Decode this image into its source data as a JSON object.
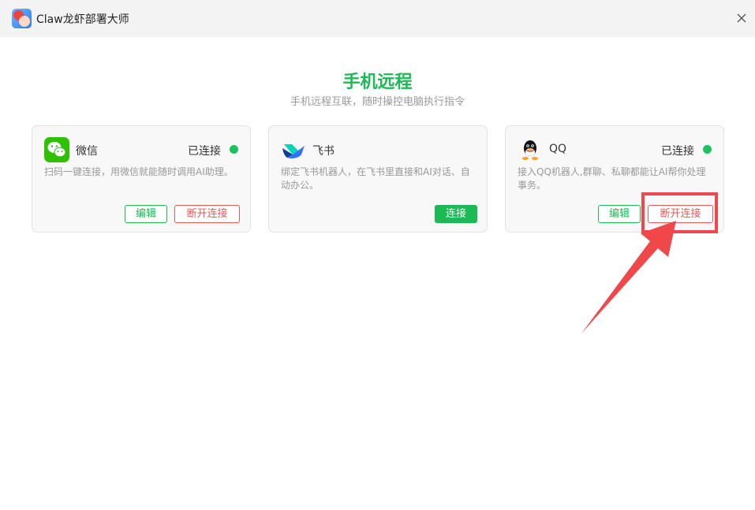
{
  "window": {
    "title": "Claw龙虾部署大师",
    "close_icon": "close-icon"
  },
  "page": {
    "title": "手机远程",
    "subtitle": "手机远程互联，随时操控电脑执行指令"
  },
  "cards": [
    {
      "name": "微信",
      "icon": "wechat-icon",
      "status": "已连接",
      "connected": true,
      "description": "扫码一键连接，用微信就能随时调用AI助理。",
      "edit_label": "编辑",
      "disconnect_label": "断开连接"
    },
    {
      "name": "飞书",
      "icon": "feishu-icon",
      "status": "",
      "connected": false,
      "description": "绑定飞书机器人，在飞书里直接和AI对话、自动办公。",
      "connect_label": "连接"
    },
    {
      "name": "QQ",
      "icon": "qq-icon",
      "status": "已连接",
      "connected": true,
      "description": "接入QQ机器人,群聊、私聊都能让AI帮你处理事务。",
      "edit_label": "编辑",
      "disconnect_label": "断开连接"
    }
  ],
  "colors": {
    "accent": "#1db954",
    "danger": "#e85a5a",
    "status_dot": "#1ec15f",
    "annotation": "#f0474a"
  }
}
